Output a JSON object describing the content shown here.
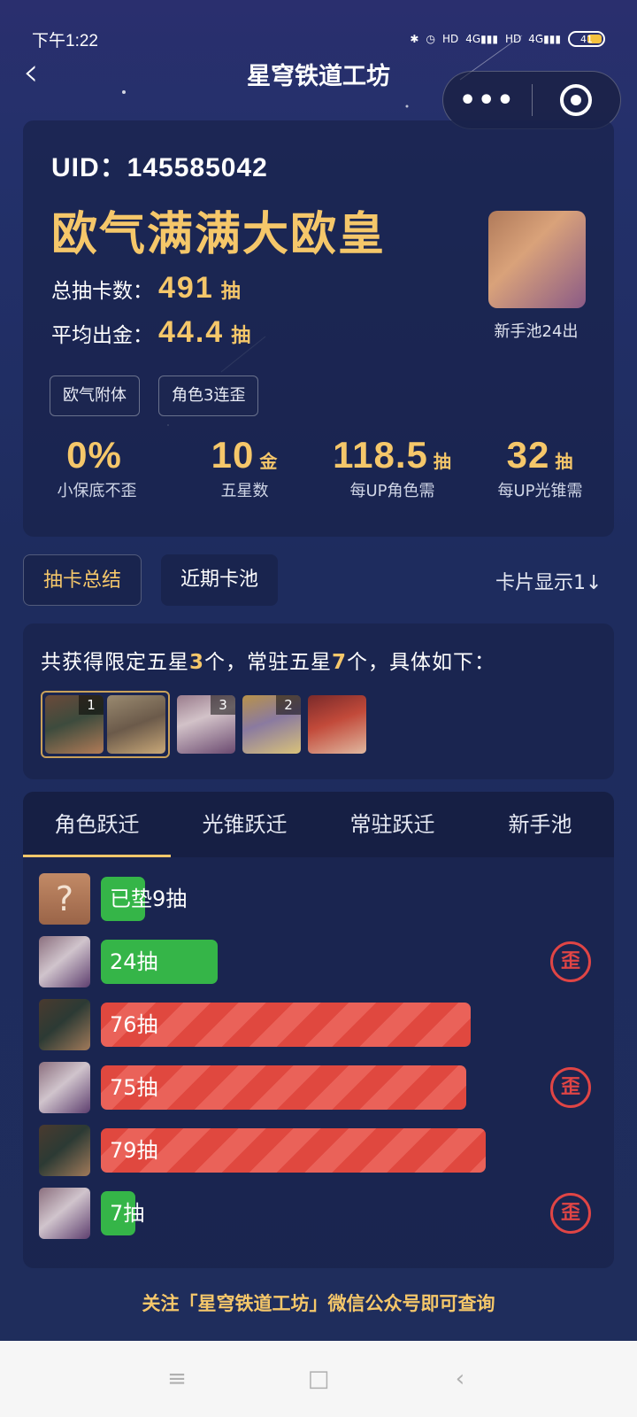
{
  "status_bar": {
    "time": "下午1:22",
    "battery": "41",
    "icons": [
      "bluetooth-icon",
      "alarm-icon",
      "hd-icon",
      "signal-4g-icon",
      "hd-icon",
      "signal-4g-icon"
    ]
  },
  "nav": {
    "title": "星穹铁道工坊",
    "more_label": "•••"
  },
  "profile": {
    "uid": "UID：145585042",
    "title": "欧气满满大欧皇",
    "total_label": "总抽卡数：",
    "total_value": "491",
    "total_unit": "抽",
    "avg_label": "平均出金：",
    "avg_value": "44.4",
    "avg_unit": "抽",
    "tags": [
      "欧气附体",
      "角色3连歪"
    ],
    "avatar_caption": "新手池24出"
  },
  "stats": [
    {
      "value": "0%",
      "unit": "",
      "label": "小保底不歪"
    },
    {
      "value": "10",
      "unit": "金",
      "label": "五星数"
    },
    {
      "value": "118.5",
      "unit": "抽",
      "label": "每UP角色需"
    },
    {
      "value": "32",
      "unit": "抽",
      "label": "每UP光锥需"
    }
  ],
  "main_tabs": {
    "summary": "抽卡总结",
    "recent": "近期卡池",
    "display_toggle": "卡片显示1↓"
  },
  "summary": {
    "prefix": "共获得限定五星",
    "limited_count": "3",
    "middle": "个，常驻五星",
    "standard_count": "7",
    "suffix": "个，具体如下：",
    "thumbnails": [
      {
        "count": "1"
      },
      {
        "count": ""
      },
      {
        "count": "3"
      },
      {
        "count": "2"
      },
      {
        "count": ""
      }
    ]
  },
  "history": {
    "tabs": [
      "角色跃迁",
      "光锥跃迁",
      "常驻跃迁",
      "新手池"
    ],
    "rows": [
      {
        "label": "已垫9抽",
        "pulls": 9,
        "color": "green",
        "avatar": "unknown",
        "avatar_text": "?",
        "off_banner": false
      },
      {
        "label": "24抽",
        "pulls": 24,
        "color": "green",
        "avatar": "silver",
        "off_banner": true
      },
      {
        "label": "76抽",
        "pulls": 76,
        "color": "red",
        "avatar": "dark",
        "off_banner": false
      },
      {
        "label": "75抽",
        "pulls": 75,
        "color": "red",
        "avatar": "silver",
        "off_banner": true
      },
      {
        "label": "79抽",
        "pulls": 79,
        "color": "red",
        "avatar": "dark",
        "off_banner": false
      },
      {
        "label": "7抽",
        "pulls": 7,
        "color": "green",
        "avatar": "silver",
        "off_banner": true
      }
    ],
    "max_pulls": 80,
    "stamp_text": "歪"
  },
  "footer": "关注「星穹铁道工坊」微信公众号即可查询",
  "system_nav": {
    "menu": "≡",
    "home": "□",
    "back": "‹"
  },
  "colors": {
    "gold": "#f5c76a",
    "green": "#35b548",
    "red": "#e0483f"
  }
}
